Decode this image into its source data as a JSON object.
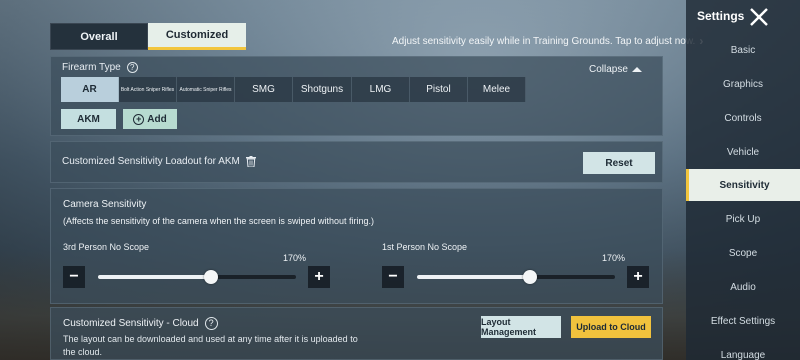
{
  "tabs": {
    "overall": "Overall",
    "customized": "Customized"
  },
  "tip": {
    "text": "Adjust sensitivity easily while in Training Grounds. Tap to adjust now."
  },
  "firearm": {
    "label": "Firearm Type",
    "collapse": "Collapse",
    "types": [
      "AR",
      "Bolt Action Sniper Rifles",
      "Automatic Sniper Rifles",
      "SMG",
      "Shotguns",
      "LMG",
      "Pistol",
      "Melee"
    ],
    "selected_type": "AR",
    "selected_gun": "AKM",
    "add_label": "Add"
  },
  "loadout": {
    "title": "Customized Sensitivity Loadout for AKM",
    "reset": "Reset"
  },
  "camera": {
    "title": "Camera Sensitivity",
    "desc": "(Affects the sensitivity of the camera when the screen is swiped without firing.)",
    "sliders": [
      {
        "label": "3rd Person No Scope",
        "value": "170%",
        "fraction": 0.57
      },
      {
        "label": "1st Person No Scope",
        "value": "170%",
        "fraction": 0.57
      }
    ]
  },
  "cloud": {
    "title": "Customized Sensitivity - Cloud",
    "desc": "The layout can be downloaded and used at any time after it is uploaded to the cloud.",
    "layout_button": "Layout Management",
    "upload_button": "Upload to Cloud"
  },
  "sidebar": {
    "title": "Settings",
    "items": [
      "Basic",
      "Graphics",
      "Controls",
      "Vehicle",
      "Sensitivity",
      "Pick Up",
      "Scope",
      "Audio",
      "Effect Settings",
      "Language"
    ],
    "active": "Sensitivity"
  },
  "colors": {
    "accent": "#f2c53d",
    "panel": "#3c4e5c",
    "selected": "#b9cfdc"
  }
}
